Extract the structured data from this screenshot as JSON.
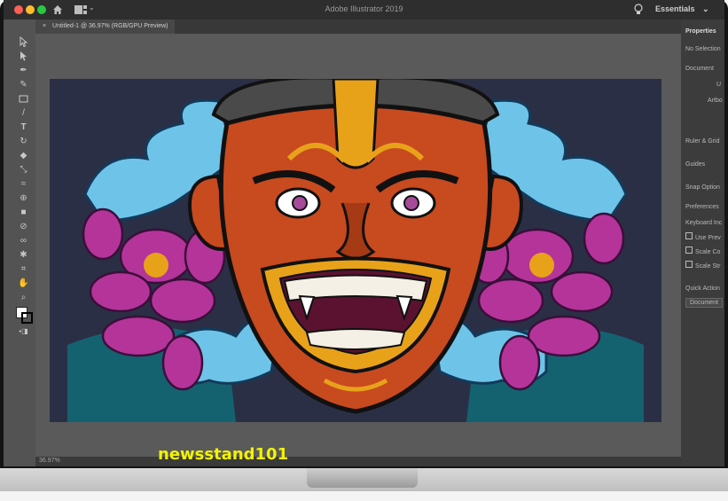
{
  "window": {
    "title": "Adobe Illustrator 2019",
    "workspace": "Essentials",
    "traffic_lights": [
      "close",
      "minimize",
      "zoom"
    ]
  },
  "document_tab": {
    "close_glyph": "×",
    "label": "Untitled-1 @ 36.97% (RGB/GPU Preview)"
  },
  "status": {
    "zoom": "36.97%"
  },
  "properties_panel": {
    "header": "Properties",
    "items": [
      "No Selection",
      "Document",
      "U",
      "Artbo",
      "Ruler & Grid",
      "Guides",
      "Snap Option",
      "Preferences",
      "Keyboard Inc",
      "Use Prev",
      "Scale Co",
      "Scale Str",
      "Quick Action",
      "Document"
    ]
  },
  "tools": [
    "selection-tool",
    "direct-selection-tool",
    "pen-tool",
    "curvature-tool",
    "rectangle-tool",
    "paintbrush-tool",
    "type-tool",
    "rotate-tool",
    "eraser-tool",
    "scale-tool",
    "width-tool",
    "shape-builder-tool",
    "gradient-tool",
    "eyedropper-tool",
    "blend-tool",
    "symbol-sprayer-tool",
    "artboard-tool",
    "hand-tool",
    "zoom-tool"
  ],
  "watermark": "newsstand101",
  "colors": {
    "canvas_bg": "#2b2f45",
    "mask_red": "#c84a1f",
    "flower_magenta": "#b5349a",
    "wave_blue": "#6ec4e8",
    "fill_swatch": "#ffffff",
    "stroke_swatch": "#000000"
  }
}
